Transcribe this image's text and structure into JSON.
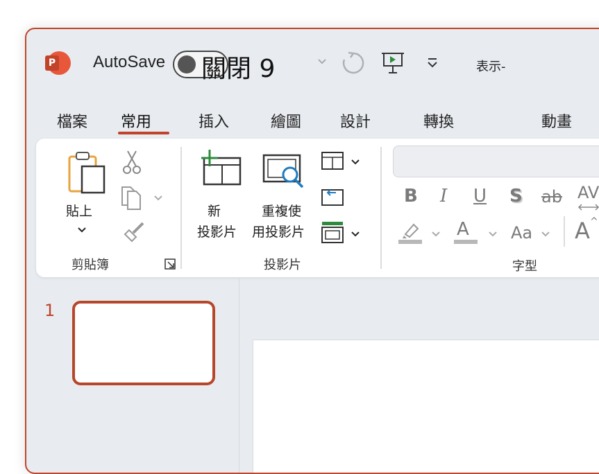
{
  "titlebar": {
    "app_icon_letter": "P",
    "autosave_label": "AutoSave",
    "autosave_state": "關閉 9",
    "window_title": "表示-"
  },
  "tabs": [
    {
      "label": "檔案"
    },
    {
      "label": "常用"
    },
    {
      "label": "插入"
    },
    {
      "label": "繪圖"
    },
    {
      "label": "設計"
    },
    {
      "label": "轉換"
    },
    {
      "label": "動畫"
    }
  ],
  "ribbon": {
    "clipboard": {
      "paste_label": "貼上",
      "group_label": "剪貼簿"
    },
    "slides": {
      "new_slide_line1": "新",
      "new_slide_line2": "投影片",
      "reuse_line1": "重複使",
      "reuse_line2": "用投影片",
      "group_label": "投影片"
    },
    "font": {
      "bold": "B",
      "italic": "I",
      "underline": "U",
      "shadow": "S",
      "strike": "ab",
      "spacing": "AV",
      "case": "Aa",
      "grow": "A",
      "font_color": "A",
      "group_label": "字型"
    }
  },
  "slides_panel": {
    "slide_number": "1"
  },
  "colors": {
    "accent": "#c0432a",
    "ribbon_bg": "#ffffff",
    "window_bg": "#e8ecf1"
  }
}
